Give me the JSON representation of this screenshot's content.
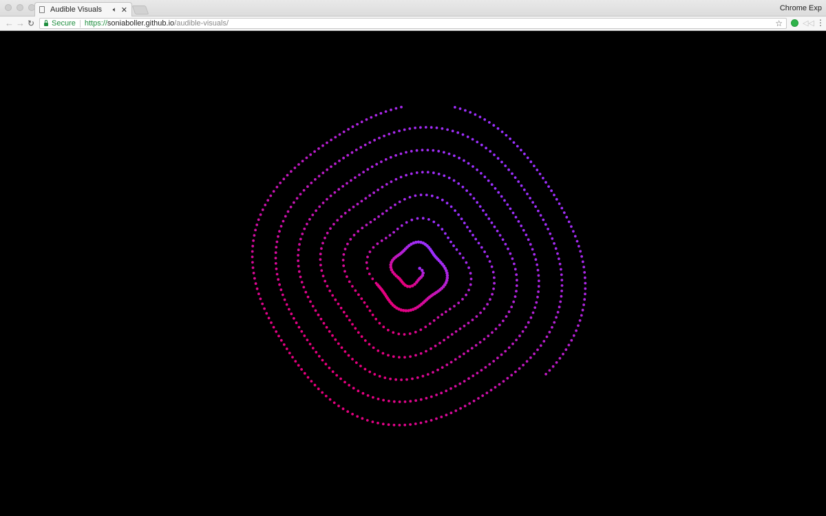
{
  "tab": {
    "title": "Audible Visuals",
    "audio_icon": "speaker-icon",
    "close_glyph": "✕"
  },
  "window": {
    "profile_label": "Chrome Exp"
  },
  "toolbar": {
    "back_glyph": "←",
    "forward_glyph": "→",
    "reload_glyph": "↻",
    "secure_label": "Secure",
    "url_scheme": "https://",
    "url_host": "soniaboller.github.io",
    "url_path": "/audible-visuals/",
    "bookmark_glyph": "☆",
    "menu_glyph": "⋮"
  },
  "visualizer": {
    "background": "#000000",
    "colors": {
      "purple": "#9b30ff",
      "magenta": "#e6007e"
    }
  }
}
